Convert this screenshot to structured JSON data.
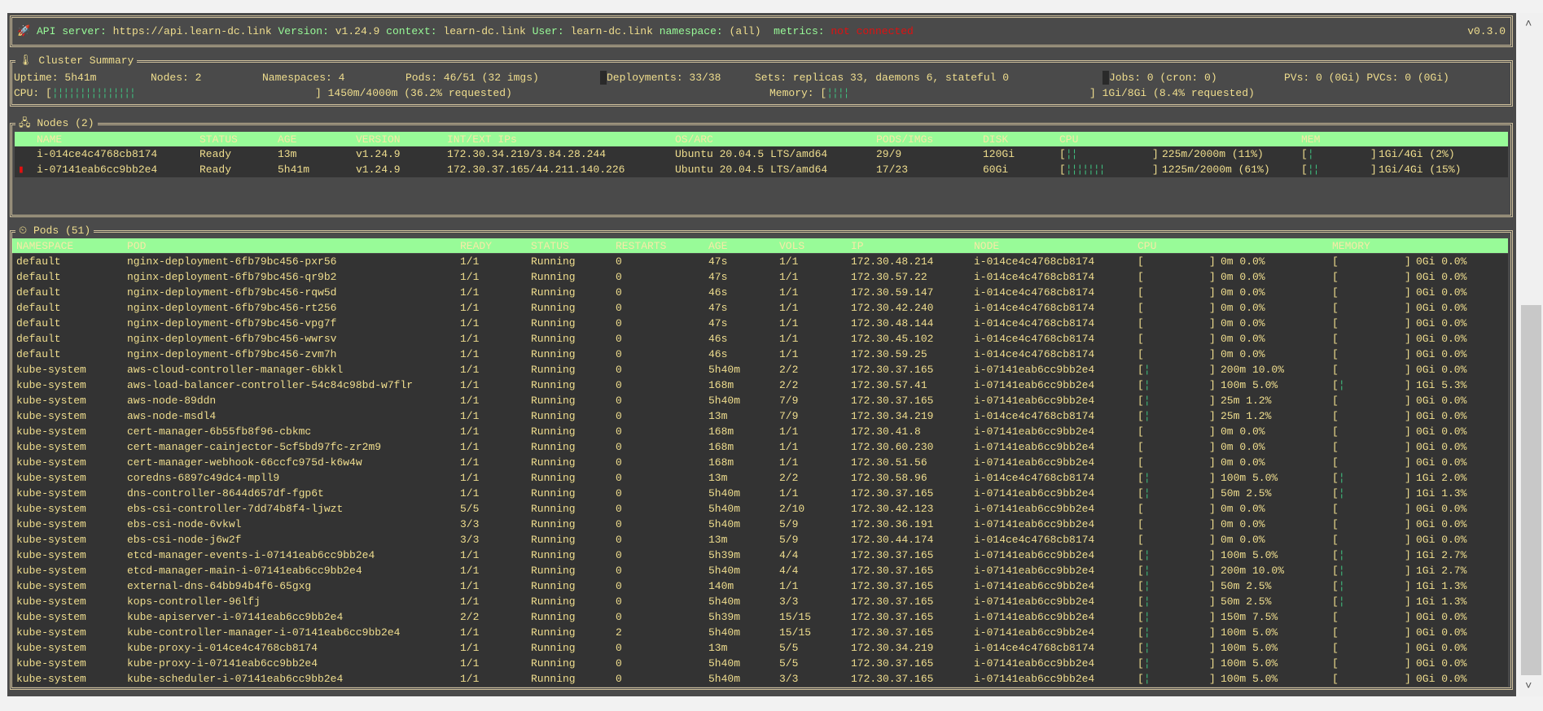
{
  "header": {
    "icon": "rocket-icon",
    "api_label": "API server:",
    "api": "https://api.learn-dc.link",
    "version_label": "Version:",
    "version": "v1.24.9",
    "context_label": "context:",
    "context": "learn-dc.link",
    "user_label": "User:",
    "user": "learn-dc.link",
    "namespace_label": "namespace:",
    "namespace": "(all)",
    "metrics_label": "metrics:",
    "metrics": "not connected",
    "app_version": "v0.3.0"
  },
  "summary": {
    "title": "Cluster Summary",
    "icon": "thermometer-icon",
    "uptime": "Uptime: 5h41m",
    "nodes": "Nodes: 2",
    "namespaces": "Namespaces: 4",
    "pods": "Pods: 46/51 (32 imgs)",
    "deployments": "Deployments: 33/38",
    "sets": "Sets: replicas 33, daemons 6, stateful 0",
    "jobs": "Jobs: 0 (cron: 0)",
    "pvs": "PVs: 0 (0Gi) PVCs: 0 (0Gi)",
    "cpu_label": "CPU: [",
    "cpu_bars": 15,
    "cpu_text": "] 1450m/4000m (36.2% requested)",
    "mem_label": "Memory: [",
    "mem_bars": 4,
    "mem_text": "] 1Gi/8Gi (8.4% requested)"
  },
  "colors": {
    "accent": "#98fb98",
    "text": "#f0de8e",
    "error": "#e01010",
    "bar": "#3fbf7f"
  },
  "nodes": {
    "title": "Nodes (2)",
    "icon": "server-icon",
    "columns": [
      "NAME",
      "STATUS",
      "AGE",
      "VERSION",
      "INT/EXT IPs",
      "OS/ARC",
      "PODS/IMGs",
      "DISK",
      "CPU",
      "MEM"
    ],
    "rows": [
      {
        "name": "i-014ce4c4768cb8174",
        "status": "Ready",
        "age": "13m",
        "version": "v1.24.9",
        "ips": "172.30.34.219/3.84.28.244",
        "os": "Ubuntu 20.04.5 LTS/amd64",
        "pods": "29/9",
        "disk": "120Gi",
        "cpu_bars": 2,
        "cpu": "225m/2000m (11%)",
        "mem_bars": 1,
        "mem": "1Gi/4Gi (2%)",
        "marker": false
      },
      {
        "name": "i-07141eab6cc9bb2e4",
        "status": "Ready",
        "age": "5h41m",
        "version": "v1.24.9",
        "ips": "172.30.37.165/44.211.140.226",
        "os": "Ubuntu 20.04.5 LTS/amd64",
        "pods": "17/23",
        "disk": "60Gi",
        "cpu_bars": 7,
        "cpu": "1225m/2000m (61%)",
        "mem_bars": 2,
        "mem": "1Gi/4Gi (15%)",
        "marker": true
      }
    ]
  },
  "pods": {
    "title": "Pods (51)",
    "icon": "clock-icon",
    "columns": [
      "NAMESPACE",
      "POD",
      "READY",
      "STATUS",
      "RESTARTS",
      "AGE",
      "VOLS",
      "IP",
      "NODE",
      "CPU",
      "MEMORY"
    ],
    "rows": [
      [
        "default",
        "nginx-deployment-6fb79bc456-pxr56",
        "1/1",
        "Running",
        "0",
        "47s",
        "1/1",
        "172.30.48.214",
        "i-014ce4c4768cb8174",
        0,
        "0m 0.0%",
        0,
        "0Gi 0.0%"
      ],
      [
        "default",
        "nginx-deployment-6fb79bc456-qr9b2",
        "1/1",
        "Running",
        "0",
        "47s",
        "1/1",
        "172.30.57.22",
        "i-014ce4c4768cb8174",
        0,
        "0m 0.0%",
        0,
        "0Gi 0.0%"
      ],
      [
        "default",
        "nginx-deployment-6fb79bc456-rqw5d",
        "1/1",
        "Running",
        "0",
        "46s",
        "1/1",
        "172.30.59.147",
        "i-014ce4c4768cb8174",
        0,
        "0m 0.0%",
        0,
        "0Gi 0.0%"
      ],
      [
        "default",
        "nginx-deployment-6fb79bc456-rt256",
        "1/1",
        "Running",
        "0",
        "47s",
        "1/1",
        "172.30.42.240",
        "i-014ce4c4768cb8174",
        0,
        "0m 0.0%",
        0,
        "0Gi 0.0%"
      ],
      [
        "default",
        "nginx-deployment-6fb79bc456-vpg7f",
        "1/1",
        "Running",
        "0",
        "47s",
        "1/1",
        "172.30.48.144",
        "i-014ce4c4768cb8174",
        0,
        "0m 0.0%",
        0,
        "0Gi 0.0%"
      ],
      [
        "default",
        "nginx-deployment-6fb79bc456-wwrsv",
        "1/1",
        "Running",
        "0",
        "46s",
        "1/1",
        "172.30.45.102",
        "i-014ce4c4768cb8174",
        0,
        "0m 0.0%",
        0,
        "0Gi 0.0%"
      ],
      [
        "default",
        "nginx-deployment-6fb79bc456-zvm7h",
        "1/1",
        "Running",
        "0",
        "46s",
        "1/1",
        "172.30.59.25",
        "i-014ce4c4768cb8174",
        0,
        "0m 0.0%",
        0,
        "0Gi 0.0%"
      ],
      [
        "kube-system",
        "aws-cloud-controller-manager-6bkkl",
        "1/1",
        "Running",
        "0",
        "5h40m",
        "2/2",
        "172.30.37.165",
        "i-07141eab6cc9bb2e4",
        1,
        "200m 10.0%",
        0,
        "0Gi 0.0%"
      ],
      [
        "kube-system",
        "aws-load-balancer-controller-54c84c98bd-w7flr",
        "1/1",
        "Running",
        "0",
        "168m",
        "2/2",
        "172.30.57.41",
        "i-07141eab6cc9bb2e4",
        1,
        "100m 5.0%",
        1,
        "1Gi 5.3%"
      ],
      [
        "kube-system",
        "aws-node-89ddn",
        "1/1",
        "Running",
        "0",
        "5h40m",
        "7/9",
        "172.30.37.165",
        "i-07141eab6cc9bb2e4",
        1,
        "25m 1.2%",
        0,
        "0Gi 0.0%"
      ],
      [
        "kube-system",
        "aws-node-msdl4",
        "1/1",
        "Running",
        "0",
        "13m",
        "7/9",
        "172.30.34.219",
        "i-014ce4c4768cb8174",
        1,
        "25m 1.2%",
        0,
        "0Gi 0.0%"
      ],
      [
        "kube-system",
        "cert-manager-6b55fb8f96-cbkmc",
        "1/1",
        "Running",
        "0",
        "168m",
        "1/1",
        "172.30.41.8",
        "i-07141eab6cc9bb2e4",
        0,
        "0m 0.0%",
        0,
        "0Gi 0.0%"
      ],
      [
        "kube-system",
        "cert-manager-cainjector-5cf5bd97fc-zr2m9",
        "1/1",
        "Running",
        "0",
        "168m",
        "1/1",
        "172.30.60.230",
        "i-07141eab6cc9bb2e4",
        0,
        "0m 0.0%",
        0,
        "0Gi 0.0%"
      ],
      [
        "kube-system",
        "cert-manager-webhook-66ccfc975d-k6w4w",
        "1/1",
        "Running",
        "0",
        "168m",
        "1/1",
        "172.30.51.56",
        "i-07141eab6cc9bb2e4",
        0,
        "0m 0.0%",
        0,
        "0Gi 0.0%"
      ],
      [
        "kube-system",
        "coredns-6897c49dc4-mpll9",
        "1/1",
        "Running",
        "0",
        "13m",
        "2/2",
        "172.30.58.96",
        "i-014ce4c4768cb8174",
        1,
        "100m 5.0%",
        1,
        "1Gi 2.0%"
      ],
      [
        "kube-system",
        "dns-controller-8644d657df-fgp6t",
        "1/1",
        "Running",
        "0",
        "5h40m",
        "1/1",
        "172.30.37.165",
        "i-07141eab6cc9bb2e4",
        1,
        "50m 2.5%",
        1,
        "1Gi 1.3%"
      ],
      [
        "kube-system",
        "ebs-csi-controller-7dd74b8f4-ljwzt",
        "5/5",
        "Running",
        "0",
        "5h40m",
        "2/10",
        "172.30.42.123",
        "i-07141eab6cc9bb2e4",
        0,
        "0m 0.0%",
        0,
        "0Gi 0.0%"
      ],
      [
        "kube-system",
        "ebs-csi-node-6vkwl",
        "3/3",
        "Running",
        "0",
        "5h40m",
        "5/9",
        "172.30.36.191",
        "i-07141eab6cc9bb2e4",
        0,
        "0m 0.0%",
        0,
        "0Gi 0.0%"
      ],
      [
        "kube-system",
        "ebs-csi-node-j6w2f",
        "3/3",
        "Running",
        "0",
        "13m",
        "5/9",
        "172.30.44.174",
        "i-014ce4c4768cb8174",
        0,
        "0m 0.0%",
        0,
        "0Gi 0.0%"
      ],
      [
        "kube-system",
        "etcd-manager-events-i-07141eab6cc9bb2e4",
        "1/1",
        "Running",
        "0",
        "5h39m",
        "4/4",
        "172.30.37.165",
        "i-07141eab6cc9bb2e4",
        1,
        "100m 5.0%",
        1,
        "1Gi 2.7%"
      ],
      [
        "kube-system",
        "etcd-manager-main-i-07141eab6cc9bb2e4",
        "1/1",
        "Running",
        "0",
        "5h40m",
        "4/4",
        "172.30.37.165",
        "i-07141eab6cc9bb2e4",
        1,
        "200m 10.0%",
        1,
        "1Gi 2.7%"
      ],
      [
        "kube-system",
        "external-dns-64bb94b4f6-65gxg",
        "1/1",
        "Running",
        "0",
        "140m",
        "1/1",
        "172.30.37.165",
        "i-07141eab6cc9bb2e4",
        1,
        "50m 2.5%",
        1,
        "1Gi 1.3%"
      ],
      [
        "kube-system",
        "kops-controller-96lfj",
        "1/1",
        "Running",
        "0",
        "5h40m",
        "3/3",
        "172.30.37.165",
        "i-07141eab6cc9bb2e4",
        1,
        "50m 2.5%",
        1,
        "1Gi 1.3%"
      ],
      [
        "kube-system",
        "kube-apiserver-i-07141eab6cc9bb2e4",
        "2/2",
        "Running",
        "0",
        "5h39m",
        "15/15",
        "172.30.37.165",
        "i-07141eab6cc9bb2e4",
        1,
        "150m 7.5%",
        0,
        "0Gi 0.0%"
      ],
      [
        "kube-system",
        "kube-controller-manager-i-07141eab6cc9bb2e4",
        "1/1",
        "Running",
        "2",
        "5h40m",
        "15/15",
        "172.30.37.165",
        "i-07141eab6cc9bb2e4",
        1,
        "100m 5.0%",
        0,
        "0Gi 0.0%"
      ],
      [
        "kube-system",
        "kube-proxy-i-014ce4c4768cb8174",
        "1/1",
        "Running",
        "0",
        "13m",
        "5/5",
        "172.30.34.219",
        "i-014ce4c4768cb8174",
        1,
        "100m 5.0%",
        0,
        "0Gi 0.0%"
      ],
      [
        "kube-system",
        "kube-proxy-i-07141eab6cc9bb2e4",
        "1/1",
        "Running",
        "0",
        "5h40m",
        "5/5",
        "172.30.37.165",
        "i-07141eab6cc9bb2e4",
        1,
        "100m 5.0%",
        0,
        "0Gi 0.0%"
      ],
      [
        "kube-system",
        "kube-scheduler-i-07141eab6cc9bb2e4",
        "1/1",
        "Running",
        "0",
        "5h40m",
        "3/3",
        "172.30.37.165",
        "i-07141eab6cc9bb2e4",
        1,
        "100m 5.0%",
        0,
        "0Gi 0.0%"
      ]
    ]
  }
}
